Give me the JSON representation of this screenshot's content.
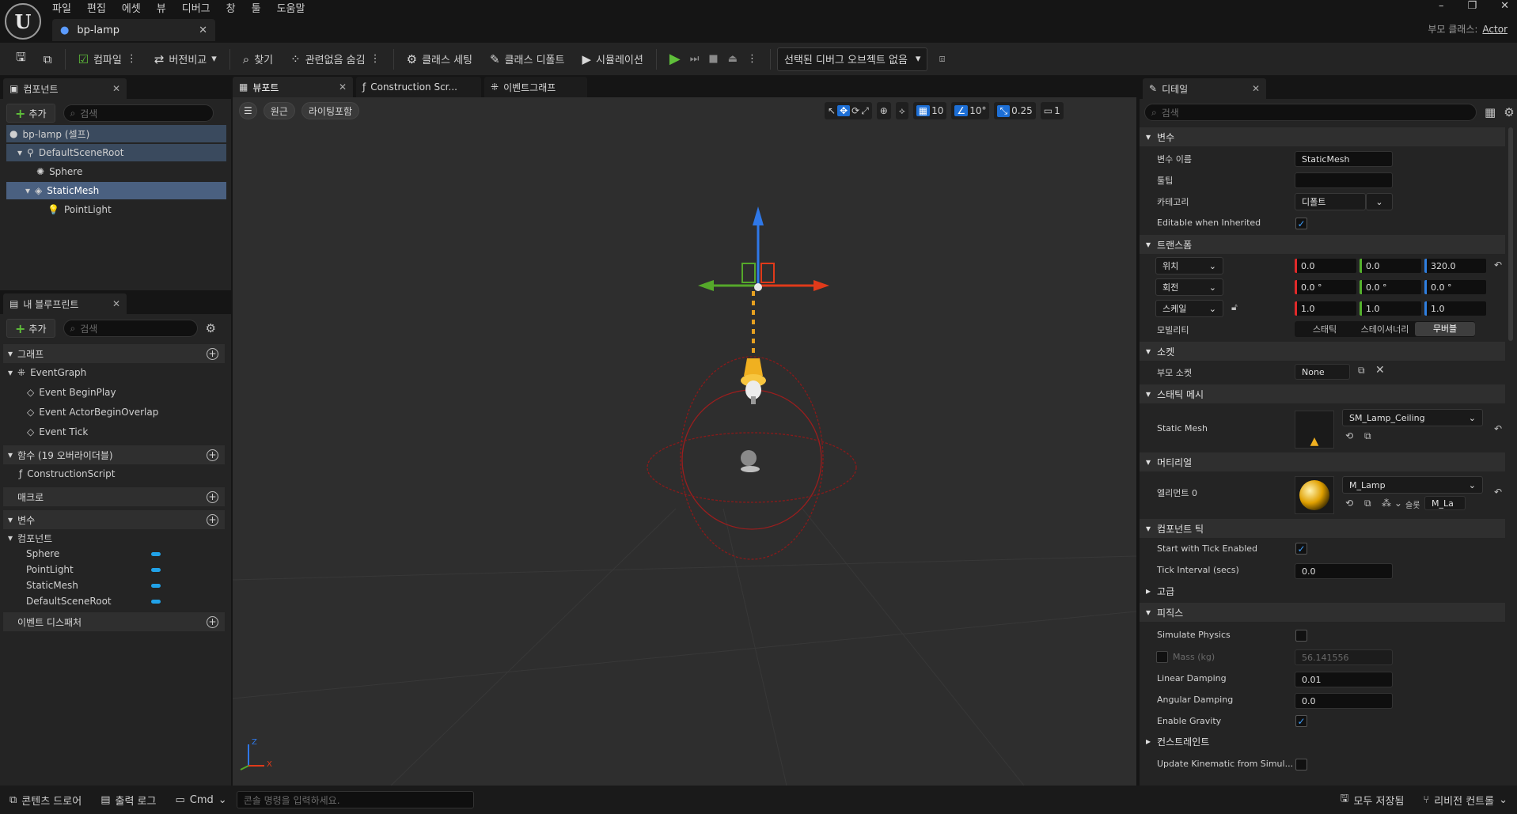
{
  "menu": [
    "파일",
    "편집",
    "에셋",
    "뷰",
    "디버그",
    "창",
    "툴",
    "도움말"
  ],
  "logo": "U",
  "document_tab": {
    "title": "bp-lamp"
  },
  "window_controls": {
    "minimize": "–",
    "restore": "❐",
    "close": "✕"
  },
  "parent_class": {
    "label": "부모 클래스:",
    "value": "Actor"
  },
  "toolbar": {
    "compile": "컴파일",
    "diff": "버전비교",
    "find": "찾기",
    "hide_unrelated": "관련없음 숨김",
    "class_settings": "클래스 세팅",
    "class_defaults": "클래스 디폴트",
    "simulation": "시뮬레이션",
    "debug_object": "선택된 디버그 오브젝트 없음"
  },
  "components_panel": {
    "tab": "컴포넌트",
    "add": "추가",
    "search_placeholder": "검색",
    "tree": [
      {
        "label": "bp-lamp (셀프)",
        "icon": "actor-icon"
      },
      {
        "label": "DefaultSceneRoot",
        "icon": "scene-root-icon"
      },
      {
        "label": "Sphere",
        "icon": "sphere-collision-icon"
      },
      {
        "label": "StaticMesh",
        "icon": "static-mesh-icon"
      },
      {
        "label": "PointLight",
        "icon": "point-light-icon"
      }
    ]
  },
  "blueprint_panel": {
    "tab": "내 블루프린트",
    "add": "추가",
    "search_placeholder": "검색",
    "graphs": "그래프",
    "event_graph": "EventGraph",
    "events": [
      "Event BeginPlay",
      "Event ActorBeginOverlap",
      "Event Tick"
    ],
    "functions": "함수 (19 오버라이더블)",
    "construction_script": "ConstructionScript",
    "macros": "매크로",
    "variables": "변수",
    "components_group": "컴포넌트",
    "component_vars": [
      "Sphere",
      "PointLight",
      "StaticMesh",
      "DefaultSceneRoot"
    ],
    "dispatchers": "이벤트 디스패처"
  },
  "editor_tabs": [
    "뷰포트",
    "Construction Scr...",
    "이벤트그래프"
  ],
  "viewport": {
    "perspective": "원근",
    "lighting": "라이팅포함",
    "grid_snap": "10",
    "rotation_snap": "10°",
    "scale_snap": "0.25",
    "camera_speed": "1",
    "axis_x": "X",
    "axis_z": "Z"
  },
  "details": {
    "tab": "디테일",
    "search_placeholder": "검색",
    "variable_section": "변수",
    "var_name_label": "변수 이름",
    "var_name": "StaticMesh",
    "tooltip_label": "툴팁",
    "category_label": "카테고리",
    "category": "디폴트",
    "editable_label": "Editable when Inherited",
    "transform_section": "트랜스폼",
    "location_label": "위치",
    "location": [
      "0.0",
      "0.0",
      "320.0"
    ],
    "rotation_label": "회전",
    "rotation": [
      "0.0 °",
      "0.0 °",
      "0.0 °"
    ],
    "scale_label": "스케일",
    "scale": [
      "1.0",
      "1.0",
      "1.0"
    ],
    "mobility_label": "모빌리티",
    "mobility": [
      "스태틱",
      "스테이셔너리",
      "무버블"
    ],
    "socket_section": "소켓",
    "parent_socket_label": "부모 소켓",
    "parent_socket": "None",
    "static_mesh_section": "스태틱 메시",
    "static_mesh_label": "Static Mesh",
    "static_mesh": "SM_Lamp_Ceiling",
    "material_section": "머티리얼",
    "element0_label": "엘리먼트 0",
    "material": "M_Lamp",
    "slot_label": "슬롯",
    "slot": "M_La",
    "tick_section": "컴포넌트 틱",
    "start_tick_label": "Start with Tick Enabled",
    "tick_interval_label": "Tick Interval (secs)",
    "tick_interval": "0.0",
    "advanced_section": "고급",
    "physics_section": "피직스",
    "simulate_label": "Simulate Physics",
    "mass_label": "Mass (kg)",
    "mass": "56.141556",
    "linear_damping_label": "Linear Damping",
    "linear_damping": "0.01",
    "angular_damping_label": "Angular Damping",
    "angular_damping": "0.0",
    "gravity_label": "Enable Gravity",
    "constraints_section": "컨스트레인트",
    "update_kinematic_label": "Update Kinematic from Simul..."
  },
  "bottom_bar": {
    "content_drawer": "콘텐츠 드로어",
    "output_log": "출력 로그",
    "cmd": "Cmd",
    "cmd_placeholder": "콘솔 명령을 입력하세요.",
    "save_all": "모두 저장됨",
    "revision_control": "리비전 컨트롤"
  },
  "colors": {
    "accent": "#1d6fd6",
    "play": "#5fbf3a",
    "selection": "#4a6080",
    "var_pill": "#21a2e8"
  }
}
